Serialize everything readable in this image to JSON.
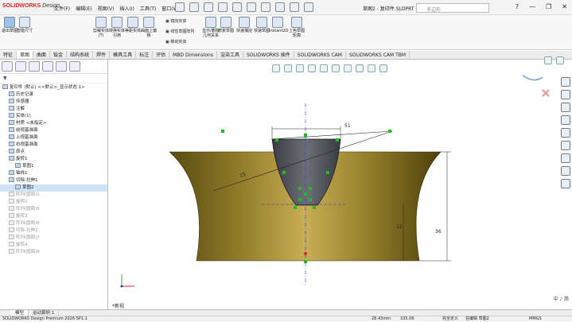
{
  "app": {
    "title_brand": "SOLIDWORKS",
    "title_suffix": "Design",
    "doc_title": "草图2 - 复印件.SLDPRT *",
    "search_placeholder": "多边形"
  },
  "menu": [
    "文件(F)",
    "编辑(E)",
    "视图(V)",
    "插入(I)",
    "工具(T)",
    "窗口(W)"
  ],
  "window_controls": [
    "?",
    "—",
    "❐",
    "✕"
  ],
  "ribbon": {
    "buttons": [
      {
        "label": "退出草图",
        "icon": "exit-sketch-icon"
      },
      {
        "label": "智能尺寸",
        "icon": "smart-dimension-icon"
      },
      {
        "label": "剪裁实体(T)",
        "icon": "trim-icon"
      },
      {
        "label": "转换实体引用",
        "icon": "convert-icon"
      },
      {
        "label": "等距实体",
        "icon": "offset-icon"
      },
      {
        "label": "曲面上偏移",
        "icon": "surface-offset-icon"
      },
      {
        "label": "显示/删除几何关系",
        "icon": "relations-icon"
      },
      {
        "label": "修复草图",
        "icon": "repair-icon"
      },
      {
        "label": "快速捕捉",
        "icon": "snap-icon"
      },
      {
        "label": "快速草图",
        "icon": "rapid-sketch-icon"
      },
      {
        "label": "Instant2D",
        "icon": "instant2d-icon"
      },
      {
        "label": "上色草图轮廓",
        "icon": "shaded-sketch-icon"
      }
    ],
    "small": [
      "镜向实体",
      "线性草图阵列",
      "移动实体"
    ]
  },
  "tabs": [
    "特征",
    "草图",
    "曲面",
    "钣金",
    "结构系统",
    "焊件",
    "模具工具",
    "标注",
    "评估",
    "MBD Dimensions",
    "渲染工具",
    "SOLIDWORKS 插件",
    "SOLIDWORKS CAM",
    "SOLIDWORKS CAM TBM"
  ],
  "active_tab": 1,
  "tree": [
    {
      "label": "复印件 (默认) <<默认>_显示状态 1>",
      "indent": 0,
      "dim": false
    },
    {
      "label": "历史记录",
      "indent": 1,
      "dim": false
    },
    {
      "label": "传感器",
      "indent": 1,
      "dim": false
    },
    {
      "label": "注解",
      "indent": 1,
      "dim": false
    },
    {
      "label": "实体(1)",
      "indent": 1,
      "dim": false
    },
    {
      "label": "材质 <未指定>",
      "indent": 1,
      "dim": false
    },
    {
      "label": "前视基准面",
      "indent": 1,
      "dim": false
    },
    {
      "label": "上视基准面",
      "indent": 1,
      "dim": false
    },
    {
      "label": "右视基准面",
      "indent": 1,
      "dim": false
    },
    {
      "label": "原点",
      "indent": 1,
      "dim": false
    },
    {
      "label": "旋转1",
      "indent": 1,
      "dim": false
    },
    {
      "label": "草图1",
      "indent": 2,
      "dim": false
    },
    {
      "label": "轴线1",
      "indent": 1,
      "dim": false
    },
    {
      "label": "切除-拉伸1",
      "indent": 1,
      "dim": false
    },
    {
      "label": "草图2",
      "indent": 2,
      "dim": false,
      "sel": true
    },
    {
      "label": "阵列(圆周)1",
      "indent": 1,
      "dim": true
    },
    {
      "label": "旋转2",
      "indent": 1,
      "dim": true
    },
    {
      "label": "阵列(圆周)5",
      "indent": 1,
      "dim": true
    },
    {
      "label": "旋转3",
      "indent": 1,
      "dim": true
    },
    {
      "label": "阵列(圆周)6",
      "indent": 1,
      "dim": true
    },
    {
      "label": "切除-拉伸2",
      "indent": 1,
      "dim": true
    },
    {
      "label": "阵列(圆周)7",
      "indent": 1,
      "dim": true
    },
    {
      "label": "旋转4",
      "indent": 1,
      "dim": true
    },
    {
      "label": "阵列(圆周)8",
      "indent": 1,
      "dim": true
    }
  ],
  "viewport": {
    "dims": {
      "top_width": "51",
      "left_height": "12",
      "right_height": "36",
      "diag": "15"
    },
    "new_study": "*新视",
    "zoom_text": "中 ♪ 简"
  },
  "bottom_tabs": [
    "模型",
    "运动算例 1"
  ],
  "status": {
    "version": "SOLIDWORKS Design Premium 2026 SP1.1",
    "x": "28.43mm",
    "y": "105.06",
    "state": "完全定义",
    "editing": "在编辑 草图2",
    "units": "MMGS"
  },
  "colors": {
    "body": "#6b5a14",
    "highlight": "#bca24a",
    "cut": "#454550",
    "sketch_green": "#15c31c",
    "dim_blue": "#2238c8"
  }
}
